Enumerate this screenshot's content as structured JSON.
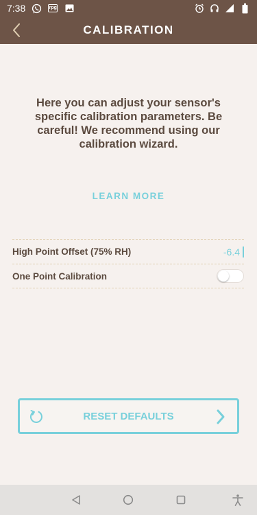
{
  "status_bar": {
    "time": "7:38",
    "left_icons": [
      "whatsapp-icon",
      "rpg-app-icon",
      "image-icon"
    ],
    "right_icons": [
      "alarm-icon",
      "headphones-icon",
      "signal-icon",
      "battery-icon"
    ]
  },
  "app_bar": {
    "title": "CALIBRATION",
    "back_icon": "chevron-left-icon"
  },
  "intro": {
    "text": "Here you can adjust your sensor's specific calibration parameters. Be careful! We recommend using our calibration wizard."
  },
  "learn_more": {
    "label": "LEARN MORE"
  },
  "settings": {
    "high_point": {
      "label": "High Point Offset (75% RH)",
      "value": "-6.4"
    },
    "one_point": {
      "label": "One Point Calibration",
      "enabled": false
    }
  },
  "reset": {
    "label": "RESET DEFAULTS",
    "left_icon": "reset-icon",
    "right_icon": "chevron-right-icon"
  },
  "nav_bar": {
    "icons": [
      "back-triangle-icon",
      "home-circle-icon",
      "recents-square-icon",
      "accessibility-icon"
    ]
  },
  "colors": {
    "header_brown": "#6d5447",
    "background": "#f6f1ee",
    "text_brown": "#5b4a3f",
    "accent_cyan": "#78d0db",
    "divider": "#e0cfb2",
    "nav_bar": "#e3e1df"
  }
}
